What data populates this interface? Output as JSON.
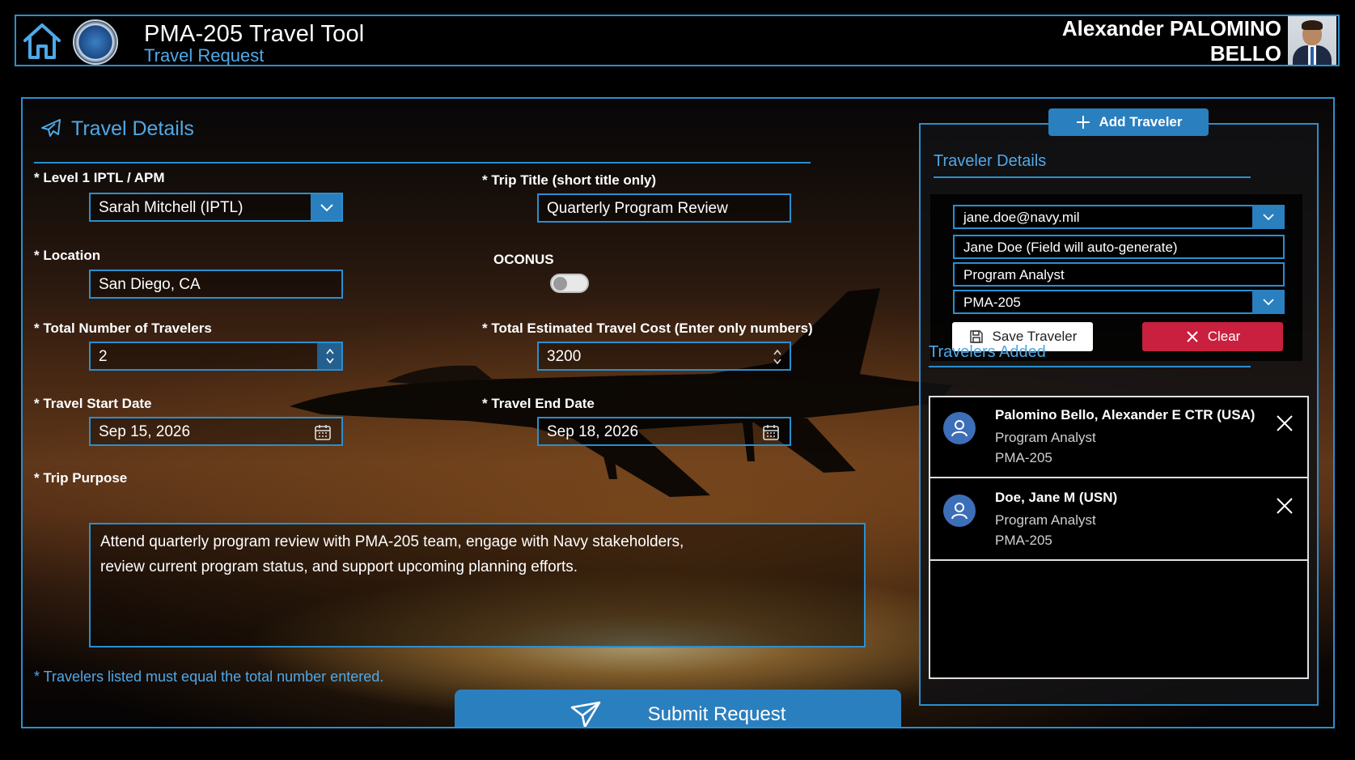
{
  "header": {
    "title": "PMA-205 Travel Tool",
    "subtitle": "Travel Request",
    "user_first": "Alexander PALOMINO",
    "user_last": "BELLO"
  },
  "travel_details": {
    "title": "Travel Details",
    "iptl_label": "* Level 1 IPTL / APM",
    "iptl_value": "Sarah Mitchell (IPTL)",
    "trip_title_label": "* Trip Title (short title only)",
    "trip_title_value": "Quarterly Program Review",
    "location_label": "* Location",
    "location_value": "San Diego, CA",
    "oconus_label": "OCONUS",
    "oconus_on": false,
    "travelers_label": "* Total Number of Travelers",
    "travelers_value": "2",
    "cost_label": "* Total Estimated Travel Cost (Enter only numbers)",
    "cost_value": "3200",
    "start_label": "* Travel Start Date",
    "start_value": "Sep 15, 2026",
    "end_label": "* Travel End Date",
    "end_value": "Sep 18, 2026",
    "purpose_label": "* Trip Purpose",
    "purpose_line1": "Attend quarterly program review with PMA-205 team, engage with Navy stakeholders,",
    "purpose_line2": "review current program status, and support upcoming planning efforts.",
    "note": "* Travelers listed must equal the total number entered.",
    "submit_label": "Submit Request"
  },
  "traveler_panel": {
    "add_label": "Add Traveler",
    "details_title": "Traveler Details",
    "email_value": "jane.doe@navy.mil",
    "name_value": "Jane Doe (Field will auto-generate)",
    "role_value": "Program Analyst",
    "org_value": "PMA-205",
    "save_label": "Save Traveler",
    "clear_label": "Clear",
    "added_title": "Travelers Added",
    "travelers": [
      {
        "name": "Palomino Bello, Alexander E CTR (USA)",
        "role": "Program Analyst",
        "org": "PMA-205"
      },
      {
        "name": "Doe, Jane M (USN)",
        "role": "Program Analyst",
        "org": "PMA-205"
      }
    ]
  },
  "colors": {
    "accent": "#2a8fd0",
    "accent_fill": "#2a7fbf",
    "title_blue": "#4fa9e8",
    "danger": "#c8203e"
  },
  "icons": [
    "home-icon",
    "seal-logo",
    "airplane-icon",
    "chevron-down-icon",
    "spinner-icon",
    "calendar-icon",
    "send-icon",
    "plus-icon",
    "save-icon",
    "close-icon",
    "person-icon"
  ]
}
